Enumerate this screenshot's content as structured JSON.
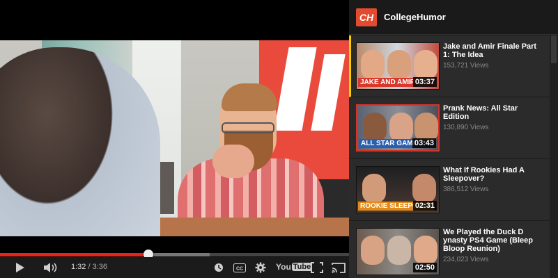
{
  "player": {
    "current_time": "1:32",
    "duration": "3:36",
    "progress": 0.426,
    "yt_logo_you": "You",
    "yt_logo_tube": "Tube"
  },
  "sidebar": {
    "channel_logo_text": "CH",
    "channel_name": "CollegeHumor",
    "items": [
      {
        "title": "Jake and Amir Finale Part 1: The Idea",
        "views": "153,721 Views",
        "duration": "03:37",
        "strap": "JAKE AND AMIR",
        "strap_color": "#d8392c"
      },
      {
        "title": "Prank News: All Star Edition",
        "views": "130,890 Views",
        "duration": "03:43",
        "strap": "ALL STAR GAME",
        "strap_color": "#2a5fb0"
      },
      {
        "title": "What If Rookies Had A Sleepover?",
        "views": "386,512 Views",
        "duration": "02:31",
        "strap": "ROOKIE SLEEPOVER",
        "strap_color": "#e08a1a"
      },
      {
        "title": "We Played the Duck D ynasty PS4 Game (Bleep Bloop Reunion)",
        "views": "234,023 Views",
        "duration": "02:50",
        "strap": "",
        "strap_color": ""
      }
    ]
  },
  "colors": {
    "progress_played": "#e1261c",
    "active_marker": "#f0d000",
    "brand": "#e24b2f"
  }
}
